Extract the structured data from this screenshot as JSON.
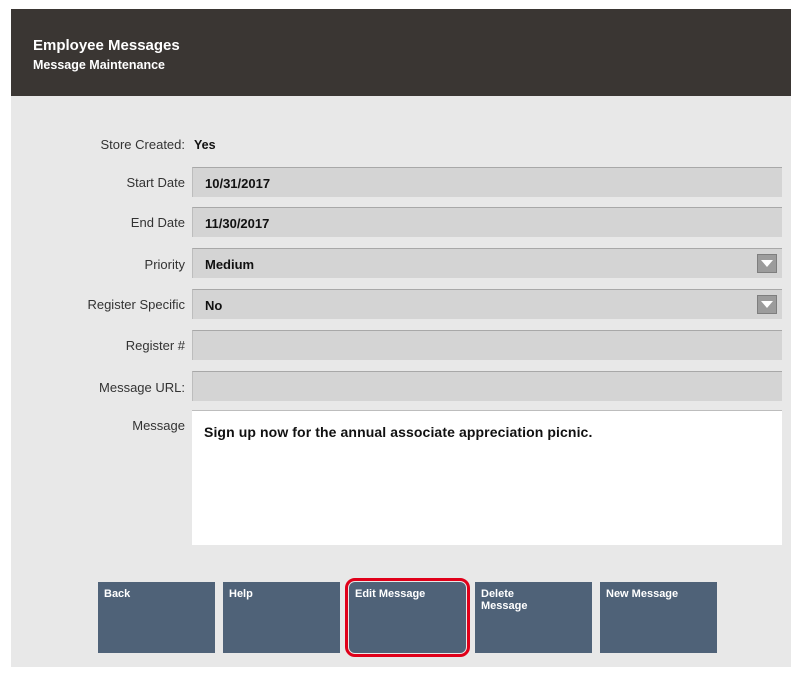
{
  "header": {
    "title": "Employee Messages",
    "subtitle": "Message Maintenance"
  },
  "form": {
    "store_created": {
      "label": "Store Created:",
      "value": "Yes"
    },
    "start_date": {
      "label": "Start Date",
      "value": "10/31/2017"
    },
    "end_date": {
      "label": "End Date",
      "value": "11/30/2017"
    },
    "priority": {
      "label": "Priority",
      "value": "Medium"
    },
    "register_specific": {
      "label": "Register Specific",
      "value": "No"
    },
    "register_number": {
      "label": "Register #",
      "value": ""
    },
    "message_url": {
      "label": "Message URL:",
      "value": ""
    },
    "message": {
      "label": "Message",
      "value": "Sign up now for the annual associate appreciation picnic."
    }
  },
  "buttons": {
    "back": "Back",
    "help": "Help",
    "edit_message": "Edit Message",
    "delete_message_line1": "Delete",
    "delete_message_line2": "Message",
    "new_message": "New Message"
  },
  "colors": {
    "header_bg": "#3a3633",
    "button_bg": "#4f6278",
    "highlight": "#e0001a"
  }
}
